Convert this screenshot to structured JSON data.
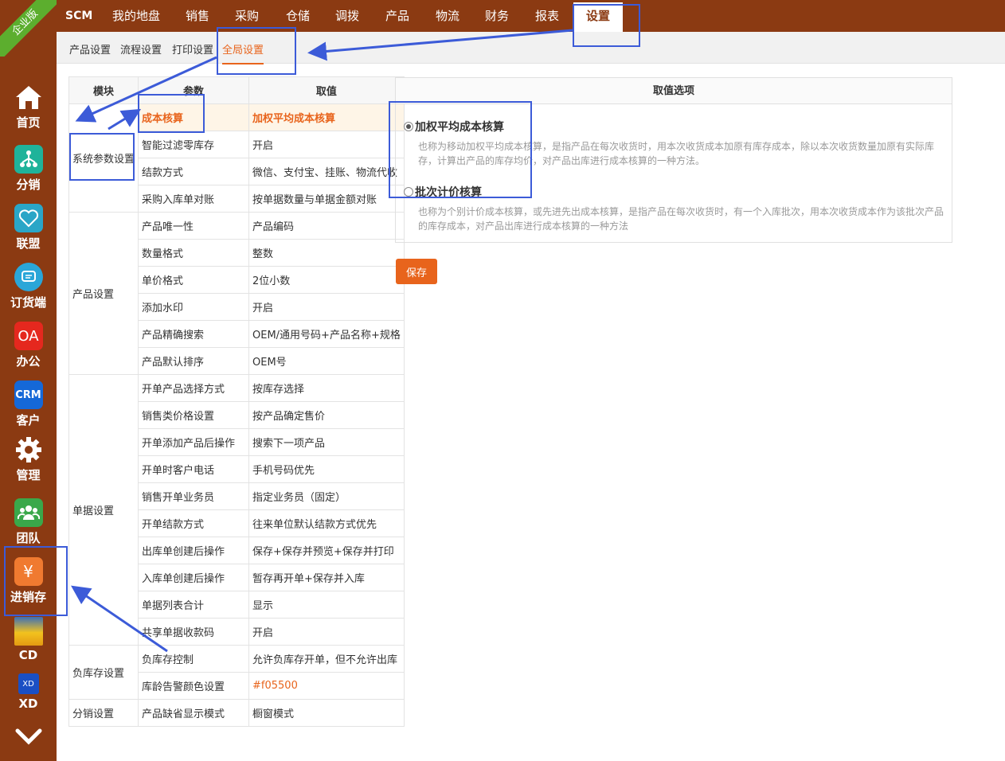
{
  "badge": "企业版",
  "sidebar": {
    "items": [
      {
        "label": "首页",
        "icon": "home-icon"
      },
      {
        "label": "分销",
        "icon": "distribution-icon"
      },
      {
        "label": "联盟",
        "icon": "alliance-icon"
      },
      {
        "label": "订货端",
        "icon": "order-chat-icon"
      },
      {
        "label": "办公",
        "icon": "oa-icon",
        "glyph": "OA"
      },
      {
        "label": "客户",
        "icon": "crm-icon",
        "glyph": "CRM"
      },
      {
        "label": "管理",
        "icon": "gear-icon"
      },
      {
        "label": "团队",
        "icon": "team-icon"
      },
      {
        "label": "进销存",
        "icon": "yen-icon",
        "glyph": "¥"
      },
      {
        "label": "CD",
        "icon": "cd-image-icon"
      },
      {
        "label": "XD",
        "icon": "xd-icon",
        "glyph": "XD"
      }
    ],
    "more": "chevron-down-icon"
  },
  "topnav": {
    "scm": "SCM",
    "items": [
      "我的地盘",
      "销售",
      "采购",
      "仓储",
      "调拨",
      "产品",
      "物流",
      "财务",
      "报表",
      "设置"
    ],
    "active": "设置"
  },
  "subnav": {
    "items": [
      "产品设置",
      "流程设置",
      "打印设置",
      "全局设置"
    ],
    "active": "全局设置"
  },
  "table": {
    "headers": [
      "模块",
      "参数",
      "取值"
    ],
    "groups": [
      {
        "module": "系统参数设置",
        "rows": [
          {
            "param": "成本核算",
            "value": "加权平均成本核算"
          },
          {
            "param": "智能过滤零库存",
            "value": "开启"
          },
          {
            "param": "结款方式",
            "value": "微信、支付宝、挂账、物流代收"
          },
          {
            "param": "采购入库单对账",
            "value": "按单据数量与单据金额对账"
          }
        ]
      },
      {
        "module": "产品设置",
        "rows": [
          {
            "param": "产品唯一性",
            "value": "产品编码"
          },
          {
            "param": "数量格式",
            "value": "整数"
          },
          {
            "param": "单价格式",
            "value": "2位小数"
          },
          {
            "param": "添加水印",
            "value": "开启"
          },
          {
            "param": "产品精确搜索",
            "value": "OEM/通用号码+产品名称+规格"
          },
          {
            "param": "产品默认排序",
            "value": "OEM号"
          }
        ]
      },
      {
        "module": "单据设置",
        "rows": [
          {
            "param": "开单产品选择方式",
            "value": "按库存选择"
          },
          {
            "param": "销售类价格设置",
            "value": "按产品确定售价"
          },
          {
            "param": "开单添加产品后操作",
            "value": "搜索下一项产品"
          },
          {
            "param": "开单时客户电话",
            "value": "手机号码优先"
          },
          {
            "param": "销售开单业务员",
            "value": "指定业务员（固定）"
          },
          {
            "param": "开单结款方式",
            "value": "往来单位默认结款方式优先"
          },
          {
            "param": "出库单创建后操作",
            "value": "保存+保存并预览+保存并打印"
          },
          {
            "param": "入库单创建后操作",
            "value": "暂存再开单+保存并入库"
          },
          {
            "param": "单据列表合计",
            "value": "显示"
          },
          {
            "param": "共享单据收款码",
            "value": "开启"
          }
        ]
      },
      {
        "module": "负库存设置",
        "rows": [
          {
            "param": "负库存控制",
            "value": "允许负库存开单，但不允许出库"
          },
          {
            "param": "库龄告警颜色设置",
            "value": "#f05500"
          }
        ]
      },
      {
        "module": "分销设置",
        "rows": [
          {
            "param": "产品缺省显示模式",
            "value": "橱窗模式"
          }
        ]
      }
    ]
  },
  "options": {
    "header": "取值选项",
    "items": [
      {
        "title": "加权平均成本核算",
        "checked": true,
        "desc": "也称为移动加权平均成本核算，是指产品在每次收货时，用本次收货成本加原有库存成本，除以本次收货数量加原有实际库存，计算出产品的库存均价，对产品出库进行成本核算的一种方法。"
      },
      {
        "title": "批次计价核算",
        "checked": false,
        "desc": "也称为个别计价成本核算，或先进先出成本核算，是指产品在每次收货时，有一个入库批次，用本次收货成本作为该批次产品的库存成本，对产品出库进行成本核算的一种方法"
      }
    ],
    "save": "保存"
  },
  "colors": {
    "brand": "#8b3a12",
    "accent": "#e8641c",
    "annotation": "#3c5bd8"
  }
}
